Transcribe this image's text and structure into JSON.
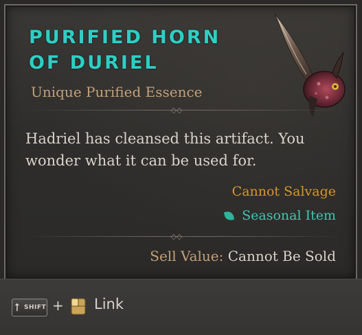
{
  "item": {
    "name_line1": "Purified Horn",
    "name_line2": "of Duriel",
    "type": "Unique Purified Essence",
    "description": "Hadriel has cleansed this artifact. You wonder what it can be used for.",
    "cannot_salvage": "Cannot Salvage",
    "seasonal": "Seasonal Item",
    "sell_label": "Sell Value:",
    "sell_value": "Cannot Be Sold",
    "image_icon": "duriel-horn-artifact-icon"
  },
  "footer": {
    "shift_key": "SHIFT",
    "plus": "+",
    "mouse_icon": "mouse-click-icon",
    "link_label": "Link"
  },
  "colors": {
    "title": "#2dcfc4",
    "type": "#c2a07a",
    "salvage": "#d8962e",
    "seasonal": "#3fc5b3",
    "text": "#d8d4cc"
  }
}
